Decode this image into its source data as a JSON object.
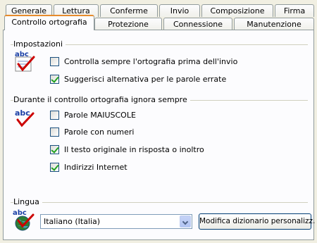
{
  "tabs_back": [
    {
      "label": "Generale"
    },
    {
      "label": "Lettura"
    },
    {
      "label": "Conferme"
    },
    {
      "label": "Invio"
    },
    {
      "label": "Composizione"
    },
    {
      "label": "Firma"
    }
  ],
  "tabs_front": [
    {
      "label": "Controllo ortografia",
      "active": true
    },
    {
      "label": "Protezione"
    },
    {
      "label": "Connessione"
    },
    {
      "label": "Manutenzione"
    }
  ],
  "impostazioni": {
    "title": "Impostazioni",
    "icon": "abc-spellcheck-icon",
    "options": [
      {
        "label": "Controlla sempre l'ortografia prima dell'invio",
        "checked": false
      },
      {
        "label": "Suggerisci alternativa per le parole errate",
        "checked": true
      }
    ]
  },
  "ignora": {
    "title": "Durante il controllo ortografia ignora sempre",
    "icon": "abc-check-icon",
    "options": [
      {
        "label": "Parole MAIUSCOLE",
        "checked": false
      },
      {
        "label": "Parole con numeri",
        "checked": false
      },
      {
        "label": "Il testo originale in risposta o inoltro",
        "checked": true
      },
      {
        "label": "Indirizzi Internet",
        "checked": true
      }
    ]
  },
  "lingua": {
    "title": "Lingua",
    "icon": "abc-globe-icon",
    "selected": "Italiano (Italia)",
    "button_label": "Modifica dizionario personalizz."
  },
  "colors": {
    "active_tab_accent": "#e68b2c",
    "check_mark": "#21a121",
    "icon_check": "#cc0000",
    "icon_text": "#1a3fa6"
  }
}
